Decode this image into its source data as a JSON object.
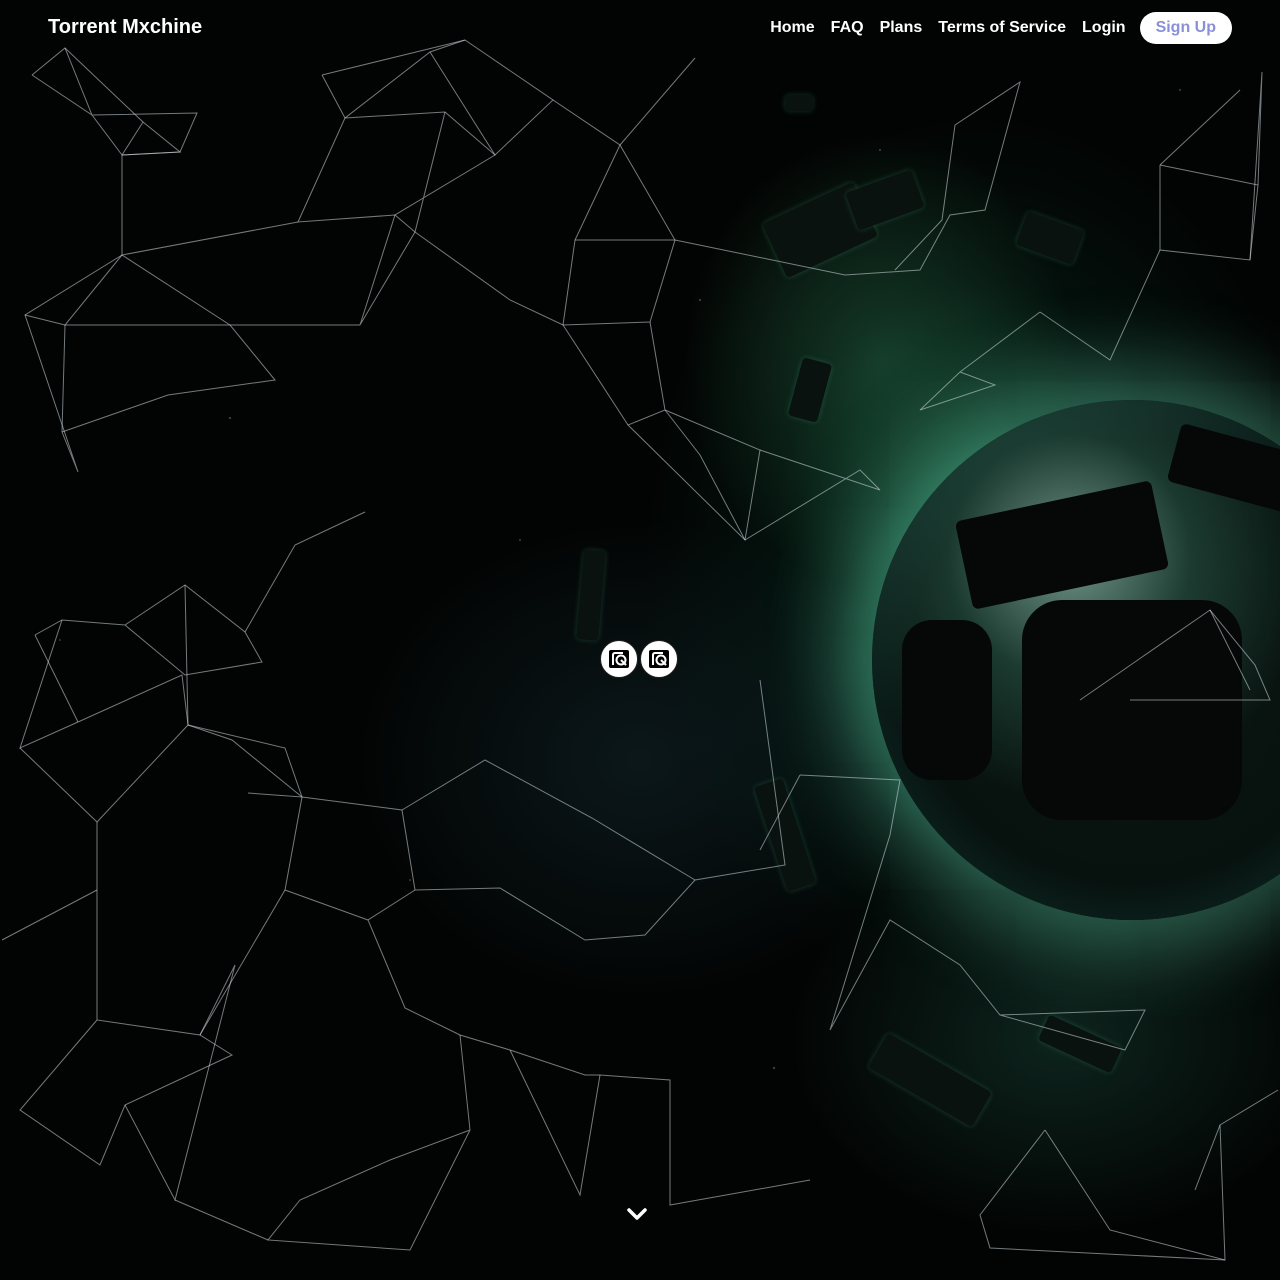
{
  "brand": {
    "name": "Torrent Mxchine"
  },
  "nav": {
    "items": [
      {
        "label": "Home"
      },
      {
        "label": "FAQ"
      },
      {
        "label": "Plans"
      },
      {
        "label": "Terms of Service"
      },
      {
        "label": "Login"
      }
    ],
    "signup_label": "Sign Up"
  },
  "colors": {
    "signup_text": "#8a90d8",
    "signup_bg": "#ffffff",
    "nav_text": "#ffffff",
    "background": "#000000",
    "glow": "#6fe0c0"
  },
  "center_logos": [
    {
      "icon": "torrent-logo-icon"
    },
    {
      "icon": "torrent-logo-icon"
    }
  ],
  "scroll_indicator": {
    "icon": "chevron-down-icon"
  }
}
